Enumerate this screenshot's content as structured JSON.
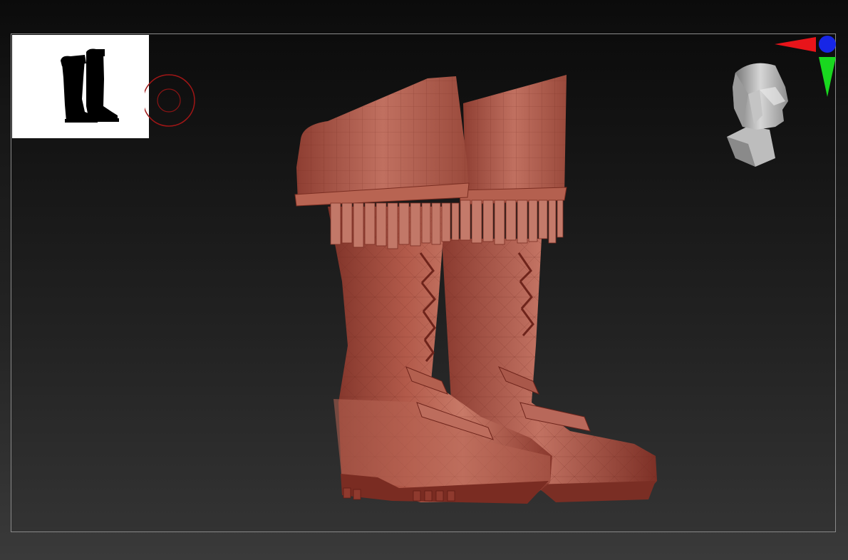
{
  "viewport": {
    "background_top": "#0c0c0c",
    "background_bottom": "#333333",
    "frame_color": "#8a8a8a"
  },
  "navigator": {
    "icon": "boot-silhouette-icon",
    "background": "#ffffff"
  },
  "brush_cursor": {
    "icon": "brush-circle-icon",
    "color": "#b01818"
  },
  "model": {
    "icon": "boots-mesh-icon",
    "material_color": "#a4473a"
  },
  "orientation_gizmo": {
    "icon": "head-gizmo-icon"
  },
  "axis_gizmo": {
    "icon": "xyz-axis-icon",
    "x_color": "#e8141a",
    "y_color": "#19d81f",
    "z_color": "#1726e6"
  }
}
